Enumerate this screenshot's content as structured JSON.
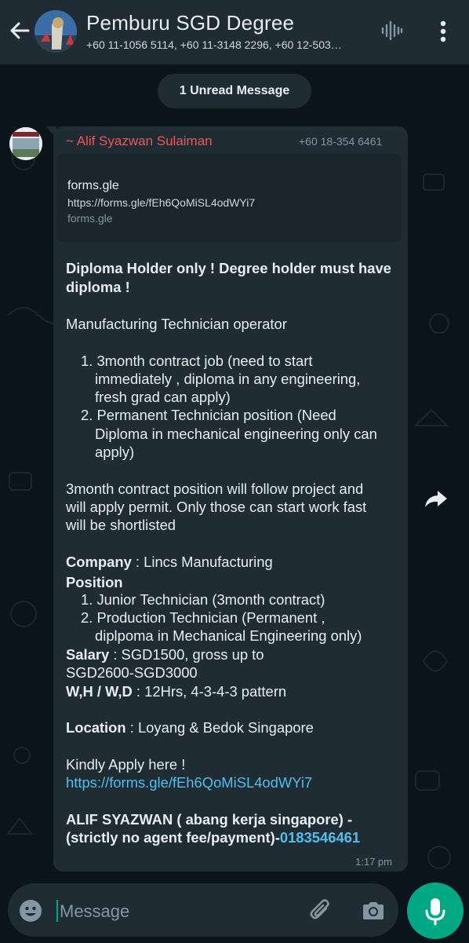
{
  "header": {
    "back_icon": "arrow-left-icon",
    "title": "Pemburu SGD Degree",
    "subtitle": "+60 11-1056 5114, +60 11-3148 2296, +60 12-503…",
    "voice_icon": "voice-call-wave-icon",
    "menu_icon": "more-vert-icon"
  },
  "unread_banner": "1 Unread Message",
  "message": {
    "sender_name": "~ Alif Syazwan Sulaiman",
    "sender_phone": "+60 18-354 6461",
    "link_preview": {
      "title": "forms.gle",
      "url": "https://forms.gle/fEh6QoMiSL4odWYi7",
      "domain": "forms.gle"
    },
    "body": {
      "heading_line1": "Diploma Holder only ! Degree holder must have",
      "heading_line2": "diploma !",
      "job_title": "Manufacturing Technician operator",
      "list1_item1_line1": "1. 3month contract job (need to start",
      "list1_item1_line2": "immediately , diploma in any engineering,",
      "list1_item1_line3": "fresh grad can apply)",
      "list1_item2_line1": "2. Permanent Technician position (Need",
      "list1_item2_line2": "Diploma in mechanical engineering only can",
      "list1_item2_line3": "apply)",
      "para_line1": "3month contract position will follow project and",
      "para_line2": "will apply permit. Only those can start work fast",
      "para_line3": "will be shortlisted",
      "company_label": "Company",
      "company_value": " : Lincs Manufacturing",
      "position_label": "Position",
      "pos_item1": "1. Junior Technician (3month contract)",
      "pos_item2_line1": "2. Production Technician (Permanent ,",
      "pos_item2_line2": "diplpoma in Mechanical Engineering only)",
      "salary_label": "Salary",
      "salary_value": " : SGD1500,  gross up to",
      "salary_line2": "SGD2600-SGD3000",
      "wh_label": "W,H / W,D",
      "wh_value": " : 12Hrs, 4-3-4-3 pattern",
      "location_label": "Location",
      "location_value": " : Loyang & Bedok Singapore",
      "apply_text": "Kindly Apply here !",
      "apply_link": "https://forms.gle/fEh6QoMiSL4odWYi7",
      "sign_line1": "ALIF SYAZWAN ( abang kerja singapore) -",
      "sign_line2": "(strictly no agent fee/payment)-",
      "sign_phone": "0183546461"
    },
    "time": "1:17 pm"
  },
  "forward_icon": "forward-share-icon",
  "input_bar": {
    "emoji_icon": "emoji-smiley-icon",
    "placeholder": "Message",
    "attach_icon": "paperclip-icon",
    "camera_icon": "camera-icon",
    "mic_icon": "microphone-icon"
  },
  "colors": {
    "background": "#0b141a",
    "header": "#1f2c34",
    "bubble": "#1f2c34",
    "sender_name": "#ec5858",
    "link": "#53bdeb",
    "accent": "#00a884"
  }
}
